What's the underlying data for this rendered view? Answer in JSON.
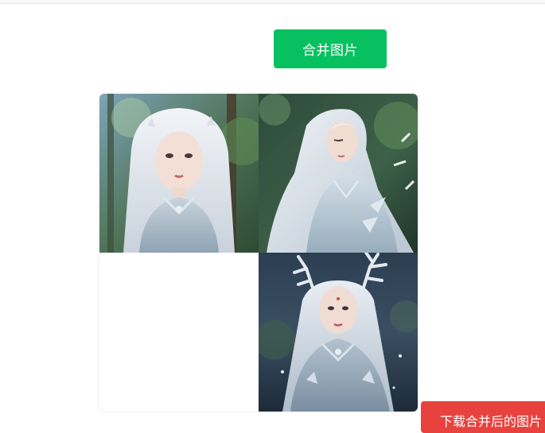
{
  "toolbar": {
    "merge_label": "合并图片",
    "download_label": "下载合并后的图片"
  },
  "colors": {
    "merge_button": "#07c160",
    "download_button": "#e8423f"
  },
  "grid": {
    "tiles": [
      {
        "slot": "top-left",
        "content": "photo"
      },
      {
        "slot": "top-right",
        "content": "photo"
      },
      {
        "slot": "bottom-left",
        "content": "empty"
      },
      {
        "slot": "bottom-right",
        "content": "photo"
      }
    ]
  }
}
